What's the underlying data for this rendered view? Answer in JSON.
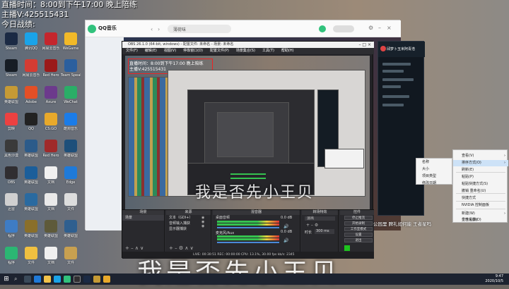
{
  "overlay": {
    "line1": "直播时间：8:00到下午17:00 晚上陪练",
    "line2": "主播V:425515431",
    "line3": "今日战绩:"
  },
  "desktop_icons": [
    {
      "label": "Steam",
      "color": "#1b2a44"
    },
    {
      "label": "腾讯QQ",
      "color": "#1aa3e8"
    },
    {
      "label": "网易云音乐",
      "color": "#c4262d"
    },
    {
      "label": "WeGame",
      "color": "#f2b928"
    },
    {
      "label": "Steam",
      "color": "#171d25"
    },
    {
      "label": "网易云音乐",
      "color": "#d43c33"
    },
    {
      "label": "Red Hero",
      "color": "#9b1a1a"
    },
    {
      "label": "Team Speak",
      "color": "#2b5f9e"
    },
    {
      "label": "英雄联盟",
      "color": "#c59a35"
    },
    {
      "label": "Adobe",
      "color": "#e34f26"
    },
    {
      "label": "Axure",
      "color": "#6c3a8c"
    },
    {
      "label": "WeChat",
      "color": "#2aae67"
    },
    {
      "label": "剪映",
      "color": "#ec4141"
    },
    {
      "label": "QQ",
      "color": "#222"
    },
    {
      "label": "CS:GO",
      "color": "#e8a92b"
    },
    {
      "label": "酷狗音乐",
      "color": "#1b7ce8"
    },
    {
      "label": "黑色沙漠",
      "color": "#3a3a3a"
    },
    {
      "label": "英雄联盟",
      "color": "#2c5b8a"
    },
    {
      "label": "Red Hero",
      "color": "#a02a2a"
    },
    {
      "label": "英雄联盟",
      "color": "#1e4f7a"
    },
    {
      "label": "OBS",
      "color": "#302e31"
    },
    {
      "label": "英雄联盟",
      "color": "#1b5e9a"
    },
    {
      "label": "文档",
      "color": "#f0f0f0"
    },
    {
      "label": "Edge",
      "color": "#1f7ad8"
    },
    {
      "label": "迅雷",
      "color": "#d0d0d0"
    },
    {
      "label": "英雄联盟",
      "color": "#2a6aa0"
    },
    {
      "label": "文档",
      "color": "#e9e9e9"
    },
    {
      "label": "文件",
      "color": "#ddd"
    },
    {
      "label": "程序",
      "color": "#3e7cc4"
    },
    {
      "label": "英雄联盟",
      "color": "#8a6f2a"
    },
    {
      "label": "英雄联盟",
      "color": "#5e5a3a"
    },
    {
      "label": "英雄联盟",
      "color": "#2f5f8f"
    },
    {
      "label": "程序",
      "color": "#2bb673"
    },
    {
      "label": "文件",
      "color": "#f0c040"
    },
    {
      "label": "文档",
      "color": "#f0f0f0"
    },
    {
      "label": "文件",
      "color": "#c8a050"
    }
  ],
  "qq_music": {
    "logo": "QQ音乐",
    "search_placeholder": "薄荷味",
    "header_text": "第",
    "rank_label": "排名",
    "ranks": [
      "1",
      "2",
      "3",
      "4"
    ]
  },
  "obs": {
    "title": "OBS 26.1.0 (64-bit, windows) - 配置文件: 未命名 - 场景: 未命名",
    "menu": [
      "文件(F)",
      "编辑(E)",
      "视图(V)",
      "停靠窗口(D)",
      "配置文件(P)",
      "场景集合(S)",
      "工具(T)",
      "帮助(H)"
    ],
    "docks": {
      "scenes": {
        "title": "场景",
        "items": [
          "场景"
        ]
      },
      "sources": {
        "title": "来源",
        "items": [
          "文本（GDI+）",
          "音频输入捕获",
          "显示器捕获"
        ]
      },
      "mixer": {
        "title": "混音器",
        "tracks": [
          {
            "name": "桌面音频",
            "db": "0.0 dB"
          },
          {
            "name": "麦克风/Aux",
            "db": "0.0 dB"
          }
        ]
      },
      "transitions": {
        "title": "转场特效",
        "type": "淡出",
        "duration_label": "时长",
        "duration": "300 ms"
      },
      "controls": {
        "title": "控件",
        "buttons": [
          "停止推流",
          "开始录制",
          "工作室模式",
          "设置",
          "退出"
        ]
      }
    },
    "status": "LIVE: 00:30:51    REC: 00:00:00    CPU: 13.1%, 30.00 fps    kb/s: 2345"
  },
  "subtitle_small": "我是否先小王贝",
  "subtitle_large": "我是否先小王贝",
  "chat": {
    "title": "邱梦卜玉米阿青浩"
  },
  "context_menu_back": [
    "名称",
    "大小",
    "项目类型",
    "修改日期"
  ],
  "context_menu": [
    {
      "label": "查看(V)",
      "arrow": true,
      "hl": false
    },
    {
      "label": "排序方式(O)",
      "arrow": true,
      "hl": true
    },
    {
      "label": "刷新(E)",
      "arrow": false,
      "hl": false
    },
    {
      "label": "粘贴(P)",
      "arrow": false,
      "hl": false
    },
    {
      "label": "粘贴快捷方式(S)",
      "arrow": false,
      "hl": false
    },
    {
      "label": "撤销 重命名(U)",
      "arrow": false,
      "hl": false
    },
    {
      "label": "快捷方式",
      "arrow": false,
      "hl": false
    },
    {
      "label": "NVIDIA 控制面板",
      "arrow": false,
      "hl": false
    },
    {
      "label": "新建(W)",
      "arrow": true,
      "hl": false
    },
    {
      "label": "显示设置(D)",
      "arrow": false,
      "hl": false
    },
    {
      "label": "个性化(R)",
      "arrow": false,
      "hl": false
    }
  ],
  "danmu": "公园里 脾礼如何能 王者星吗",
  "taskbar": {
    "time": "9:47",
    "date": "2020/10/5"
  },
  "colors": {
    "obs_bg": "#222226",
    "accent_green": "#35c34f",
    "menu_highlight": "#cde2f7"
  }
}
